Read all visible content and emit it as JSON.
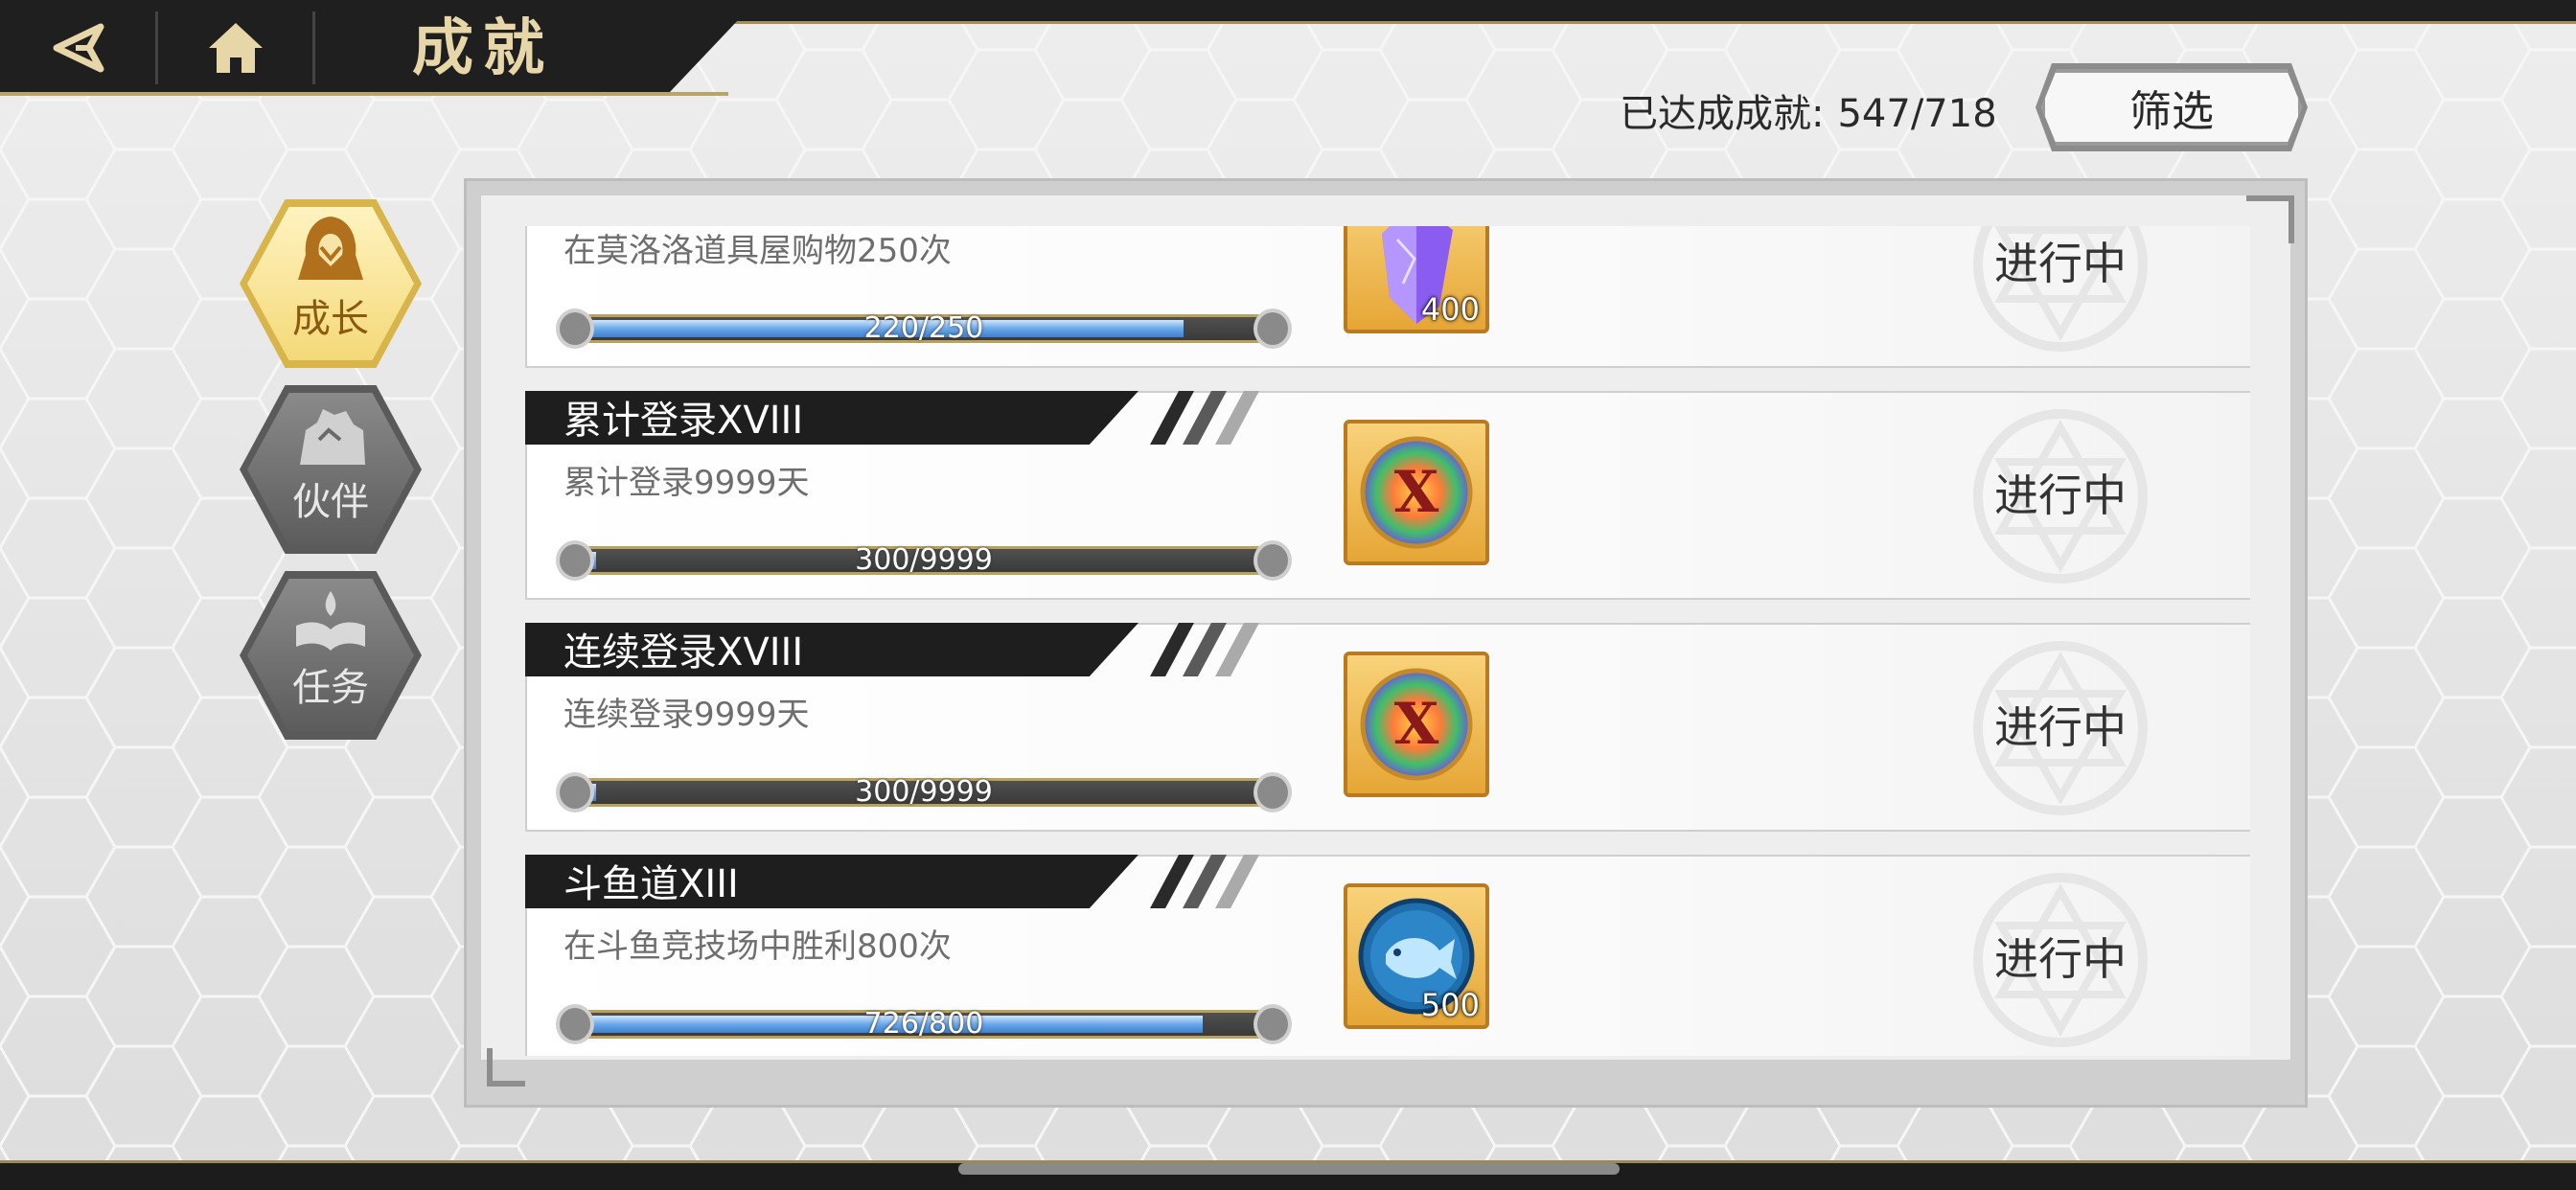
{
  "header": {
    "title": "成就",
    "back_icon": "back-arrow-icon",
    "home_icon": "home-icon"
  },
  "summary": {
    "label": "已达成成就:",
    "count": "547/718"
  },
  "filter": {
    "label": "筛选"
  },
  "nav": [
    {
      "label": "成长",
      "icon": "hooded-figure-icon",
      "active": true
    },
    {
      "label": "伙伴",
      "icon": "partners-icon",
      "active": false
    },
    {
      "label": "任务",
      "icon": "book-flame-icon",
      "active": false
    }
  ],
  "achievements": [
    {
      "title": "",
      "desc": "在莫洛洛道具屋购物250次",
      "progress_text": "220/250",
      "progress": 0.88,
      "reward_icon": "purple-crystal-icon",
      "reward_qty": "400",
      "status": "进行中"
    },
    {
      "title": "累计登录XVIII",
      "desc": "累计登录9999天",
      "progress_text": "300/9999",
      "progress": 0.03,
      "reward_icon": "rainbow-x-medal-icon",
      "reward_qty": "",
      "status": "进行中"
    },
    {
      "title": "连续登录XVIII",
      "desc": "连续登录9999天",
      "progress_text": "300/9999",
      "progress": 0.03,
      "reward_icon": "rainbow-x-medal-icon",
      "reward_qty": "",
      "status": "进行中"
    },
    {
      "title": "斗鱼道XIII",
      "desc": "在斗鱼竞技场中胜利800次",
      "progress_text": "726/800",
      "progress": 0.9075,
      "reward_icon": "blue-fish-coin-icon",
      "reward_qty": "500",
      "status": "进行中"
    }
  ],
  "colors": {
    "title_gold": "#e6d6a8",
    "progress_blue": "#6aa8e8",
    "nav_active": "#f4d978"
  }
}
